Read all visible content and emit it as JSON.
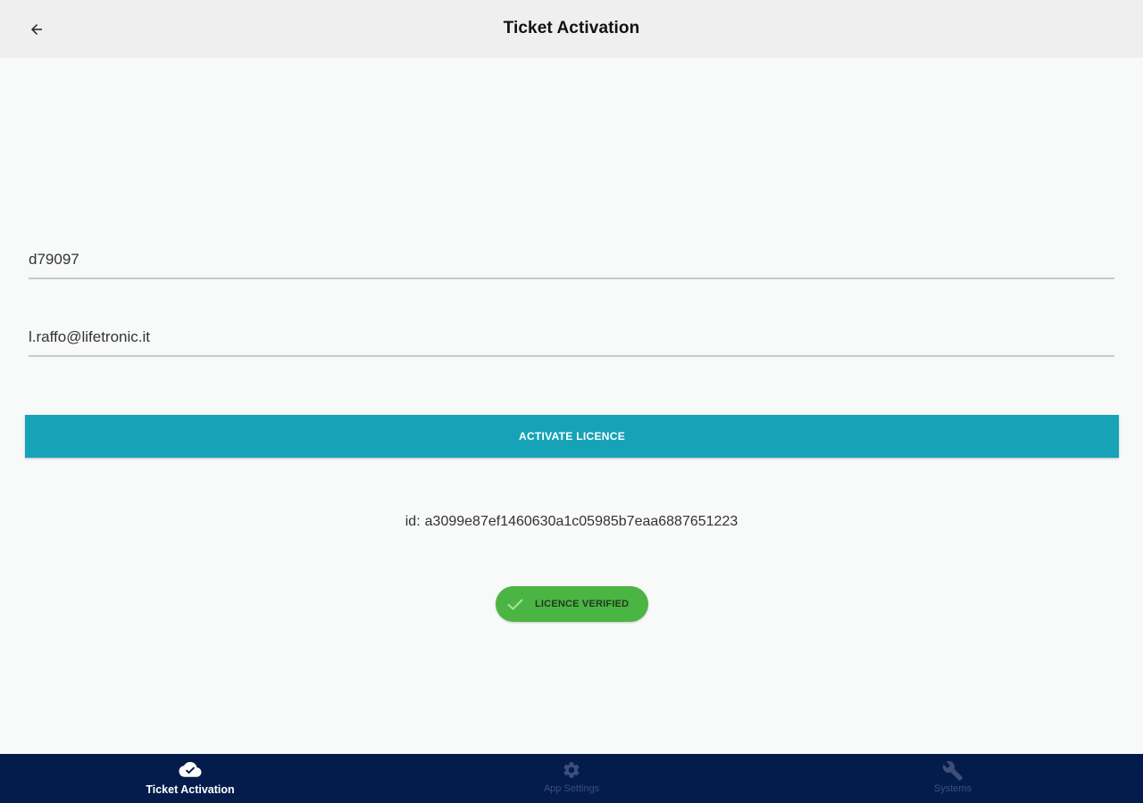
{
  "header": {
    "title": "Ticket Activation",
    "back_icon": "arrow-left-icon"
  },
  "form": {
    "code_value": "d79097",
    "email_value": "l.raffo@lifetronic.it",
    "activate_label": "ACTIVATE LICENCE",
    "activate_color": "#16a3b8"
  },
  "device": {
    "id_prefix": "id:",
    "id_value": "a3099e87ef1460630a1c05985b7eaa6887651223"
  },
  "status": {
    "label": "LICENCE VERIFIED",
    "icon": "check-icon",
    "color": "#4bb543"
  },
  "bottom_nav": {
    "background": "#041c4c",
    "items": [
      {
        "label": "Ticket Activation",
        "icon": "cloud-check-icon",
        "active": true
      },
      {
        "label": "App Settings",
        "icon": "gear-icon",
        "active": false
      },
      {
        "label": "Systems",
        "icon": "wrench-icon",
        "active": false
      }
    ]
  }
}
